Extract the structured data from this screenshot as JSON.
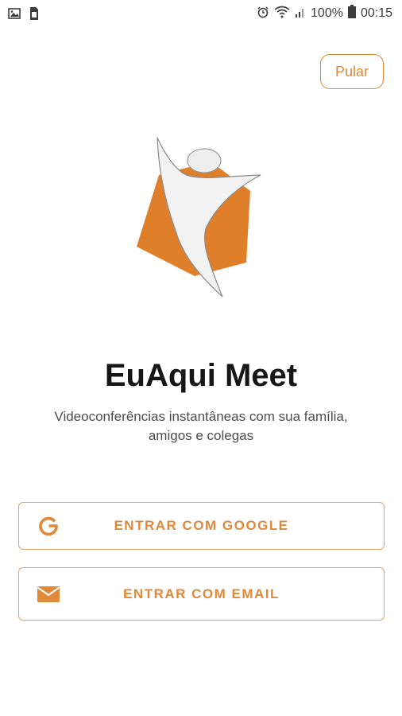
{
  "status_bar": {
    "battery": "100%",
    "time": "00:15",
    "icons": [
      "image-icon",
      "sim-icon",
      "alarm-icon",
      "wifi-icon",
      "signal-icon",
      "battery-icon"
    ]
  },
  "onboarding": {
    "skip_label": "Pular",
    "title": "EuAqui Meet",
    "subtitle": "Videoconferências instantâneas com sua família, amigos e colegas",
    "google_button_label": "ENTRAR COM GOOGLE",
    "email_button_label": "ENTRAR COM EMAIL"
  },
  "colors": {
    "accent": "#e18b3a",
    "logo_orange": "#e07f2a",
    "title": "#161616",
    "subtitle": "#4d4d4d"
  }
}
